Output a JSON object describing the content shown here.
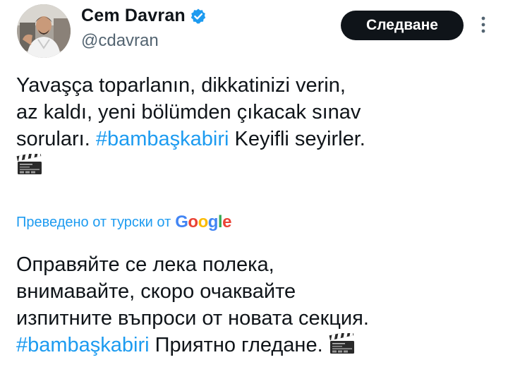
{
  "author": {
    "display_name": "Cem Davran",
    "handle": "@cdavran",
    "verified": true
  },
  "actions": {
    "follow_label": "Следване"
  },
  "original_text": {
    "line1": "Yavaşça toparlanın, dikkatinizi verin,",
    "line2": "az kaldı, yeni bölümden çıkacak sınav",
    "line3_before": "soruları. ",
    "hashtag": "#bambaşkabiri",
    "line3_after": " Keyifli seyirler."
  },
  "translation": {
    "notice": "Преведено от турски от",
    "provider_letters": [
      "G",
      "o",
      "o",
      "g",
      "l",
      "e"
    ]
  },
  "translated_text": {
    "line1": "Оправяйте се лека полека,",
    "line2": "внимавайте, скоро очаквайте",
    "line3": "изпитните въпроси от новата секция.",
    "hashtag": "#bambaşkabiri",
    "line4_after": " Приятно гледане. "
  },
  "colors": {
    "text": "#0f1419",
    "secondary_text": "#536471",
    "link": "#1d9bf0",
    "verified_badge": "#1d9bf0",
    "follow_button_bg": "#0f1419",
    "follow_button_text": "#ffffff"
  },
  "icons": {
    "verified": "verified-badge-icon",
    "more": "more-options-icon",
    "emoji": "clapper-board-icon"
  }
}
